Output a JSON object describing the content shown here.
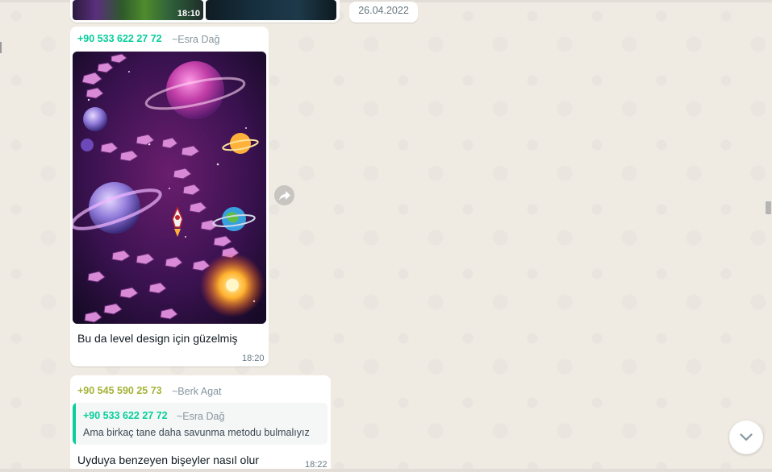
{
  "colors": {
    "wallpaper": "#efeae2",
    "bubble": "#ffffff",
    "sender_green": "#06cf9c",
    "sender_olive": "#a5b337",
    "meta_grey": "#667781"
  },
  "album": {
    "time": "18:10"
  },
  "date_separator": "26.04.2022",
  "image_message": {
    "sender_phone": "+90 533 622 27 72",
    "sender_alias": "~Esra Dağ",
    "image_icon": "space-level-design-image",
    "caption": "Bu da level design için güzelmiş",
    "time": "18:20"
  },
  "forward_icon": "forward-arrow-icon",
  "reply_message": {
    "sender_phone": "+90 545 590 25 73",
    "sender_alias": "~Berk Agat",
    "quoted": {
      "sender_phone": "+90 533 622 27 72",
      "sender_alias": "~Esra Dağ",
      "text": "Ama birkaç tane daha savunma metodu bulmalıyız"
    },
    "text": "Uyduya benzeyen bişeyler nasıl olur",
    "time": "18:22"
  },
  "scroll_down_icon": "chevron-down-icon"
}
